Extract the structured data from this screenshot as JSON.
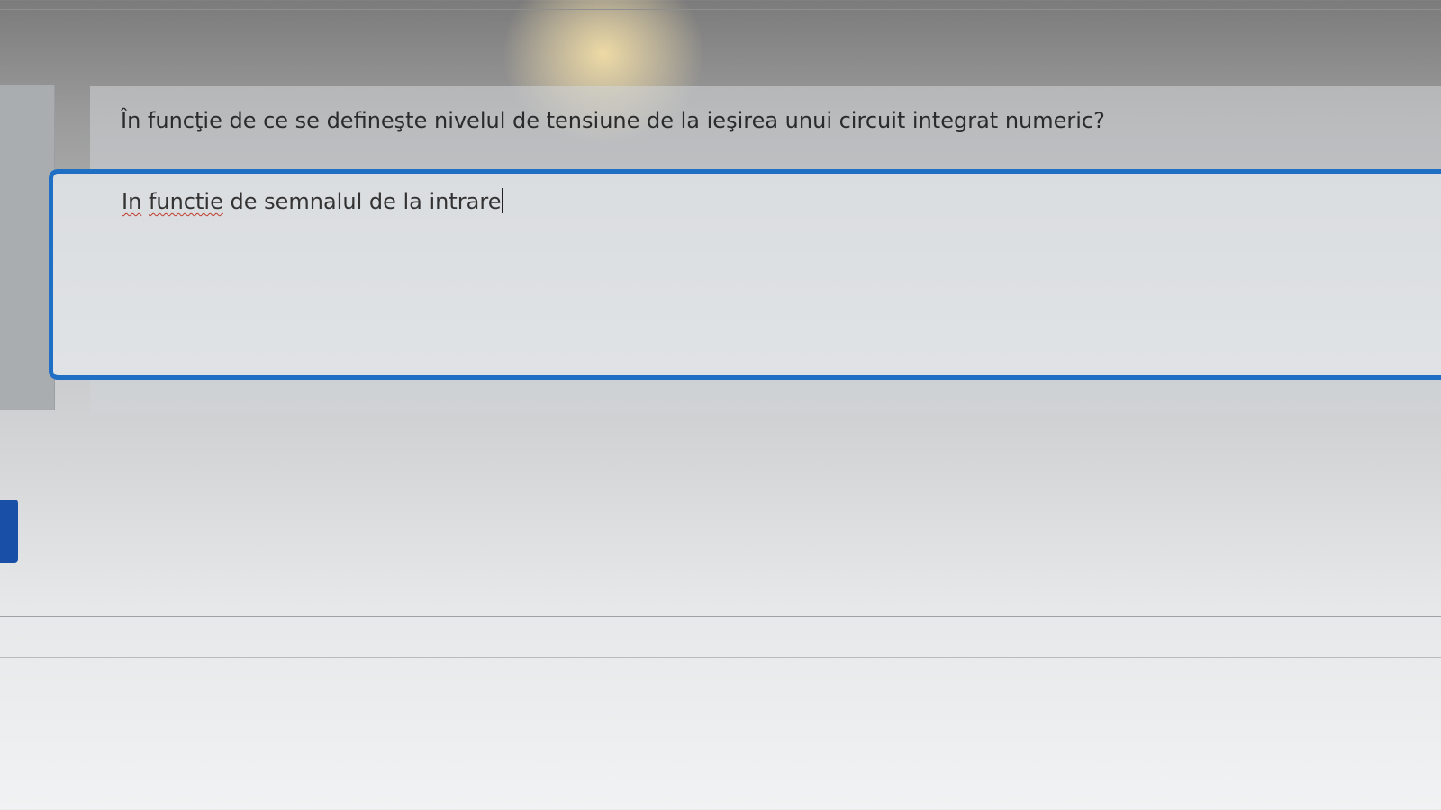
{
  "question": {
    "text": "În funcţie de ce se defineşte  nivelul de tensiune de la ieşirea unui circuit integrat numeric?"
  },
  "answer": {
    "word_1": "In",
    "word_2": "functie",
    "rest": " de semnalul de la intrare"
  },
  "colors": {
    "focus_border": "#1f6fc4",
    "side_tab": "#1a4fa8"
  }
}
